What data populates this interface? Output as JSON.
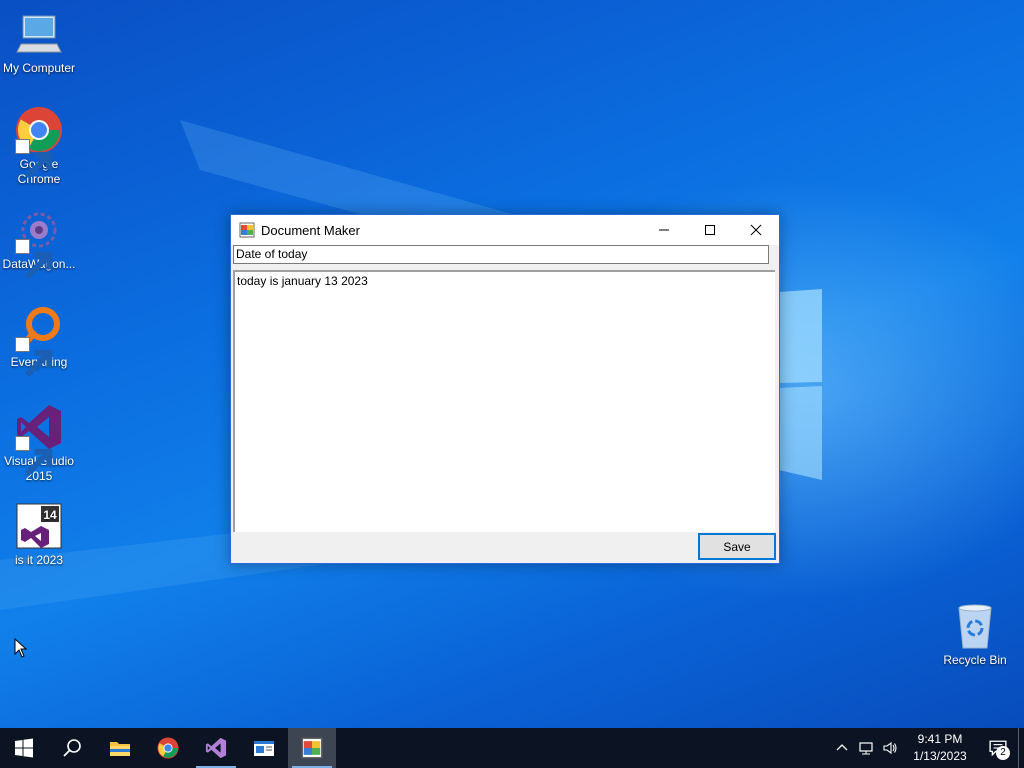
{
  "desktop": {
    "icons": [
      {
        "label": "My Computer",
        "icon": "computer-icon"
      },
      {
        "label": "Google Chrome",
        "icon": "chrome-icon"
      },
      {
        "label": "DataWagon...",
        "icon": "datawagon-icon"
      },
      {
        "label": "Everything",
        "icon": "everything-search-icon"
      },
      {
        "label": "Visual Studio 2015",
        "icon": "visual-studio-icon"
      },
      {
        "label": "is it 2023",
        "icon": "visual-studio-14-icon"
      },
      {
        "label": "Recycle Bin",
        "icon": "recycle-bin-icon"
      }
    ]
  },
  "window": {
    "title": "Document Maker",
    "title_field_value": "Date of today",
    "body_text": "today is january 13 2023",
    "save_label": "Save",
    "controls": [
      "minimize-icon",
      "maximize-icon",
      "close-icon"
    ]
  },
  "taskbar": {
    "items": [
      "windows-start-icon",
      "search-icon",
      "file-explorer-icon",
      "chrome-icon",
      "visual-studio-icon",
      "app-window-icon",
      "document-maker-icon"
    ],
    "active_item": "document-maker-icon"
  },
  "tray": {
    "time": "9:41 PM",
    "date": "1/13/2023",
    "notification_count": "2"
  },
  "colors": {
    "accent": "#0078d7",
    "taskbar": "#0c1424"
  }
}
